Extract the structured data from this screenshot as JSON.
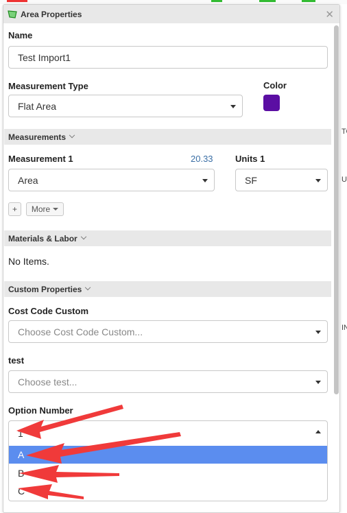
{
  "window": {
    "title": "Area Properties",
    "close_glyph": "✕",
    "title_icon": "area-polygon-icon"
  },
  "name": {
    "label": "Name",
    "value": "Test Import1"
  },
  "measurement_type": {
    "label": "Measurement Type",
    "value": "Flat Area"
  },
  "color": {
    "label": "Color",
    "value": "#5b0ea3"
  },
  "measurements_section": {
    "title": "Measurements",
    "measurement_label": "Measurement 1",
    "measurement_value": "20.33",
    "measurement_select": "Area",
    "units_label": "Units 1",
    "units_select": "SF",
    "add_label": "+",
    "more_label": "More"
  },
  "materials_section": {
    "title": "Materials & Labor",
    "empty_text": "No Items."
  },
  "custom_section": {
    "title": "Custom Properties",
    "cost_code_label": "Cost Code Custom",
    "cost_code_placeholder": "Choose Cost Code Custom...",
    "test_label": "test",
    "test_placeholder": "Choose test...",
    "option_label": "Option Number",
    "option_value": "1",
    "options": [
      "A",
      "B",
      "C"
    ],
    "highlighted_option": "A"
  },
  "background": {
    "side_letters": [
      "TO",
      "UT",
      "IN"
    ]
  },
  "colors": {
    "section_bg": "#e8e8e8",
    "highlight": "#5b8def",
    "annotation_arrow": "#f03a3a",
    "link": "#3a6ea5"
  }
}
